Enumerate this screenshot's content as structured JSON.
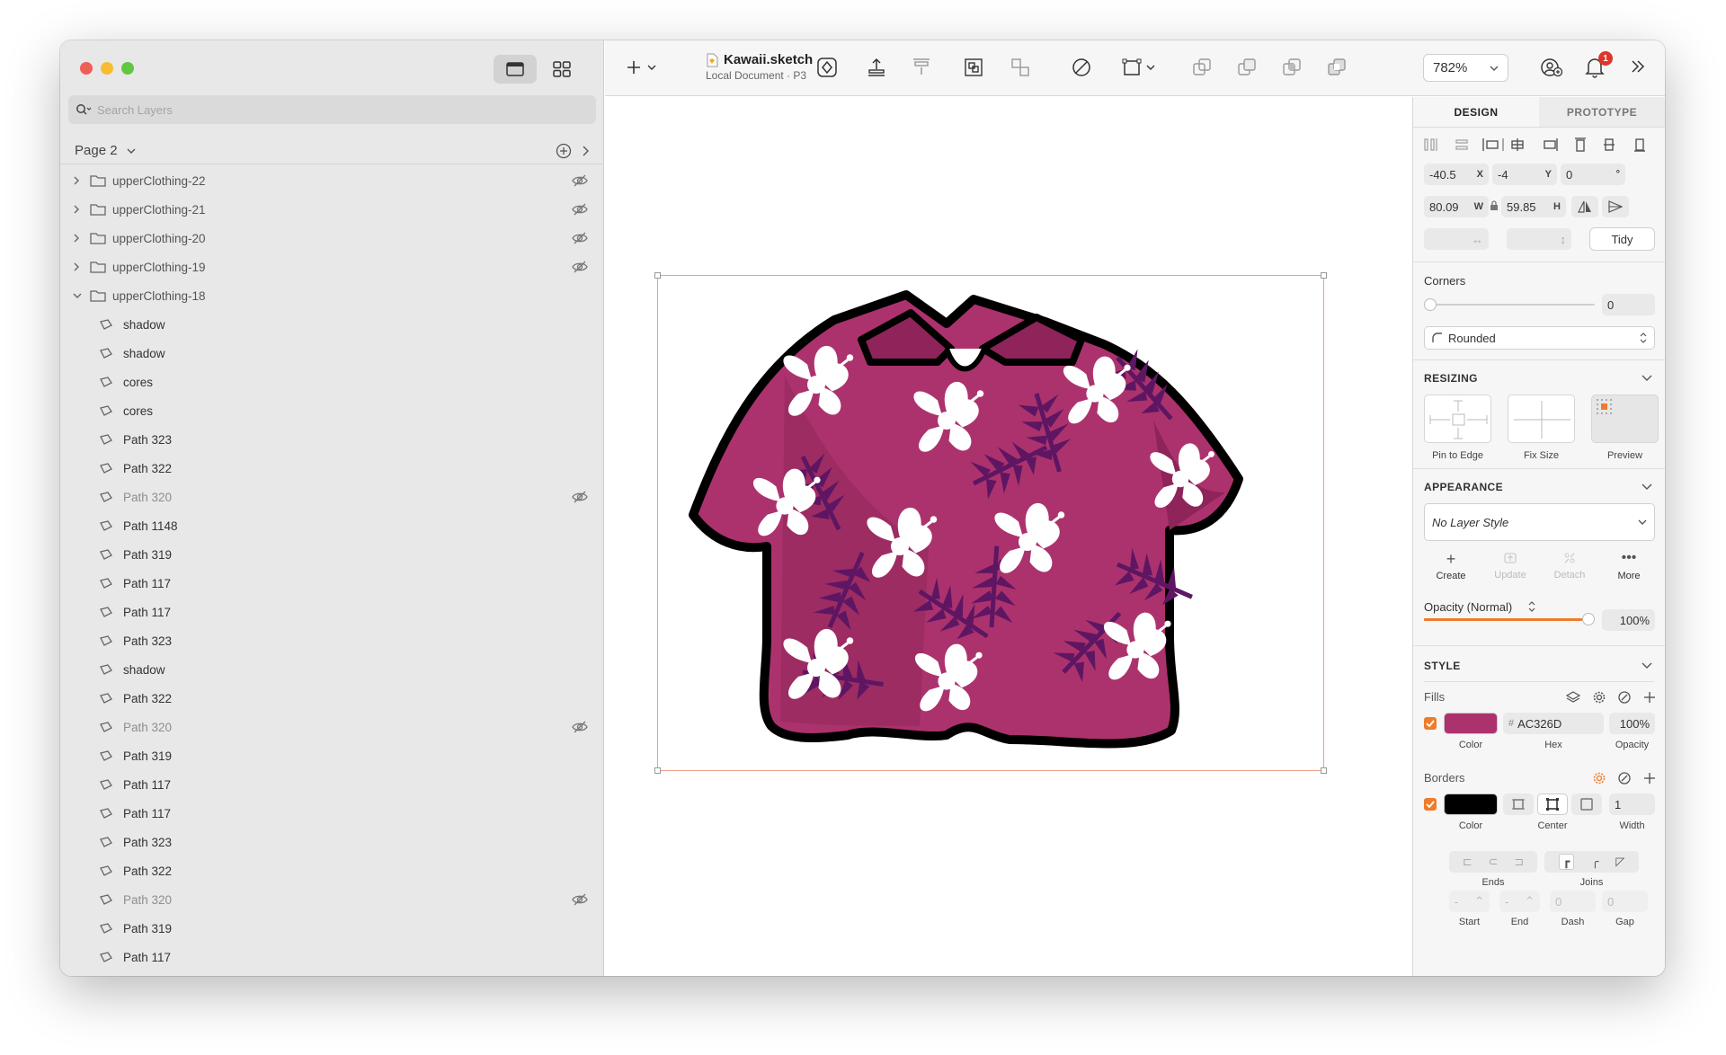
{
  "window": {
    "doc_name": "Kawaii.sketch",
    "doc_subtitle": "Local Document · P3",
    "zoom": "782%",
    "notifications": "1"
  },
  "sidebar": {
    "search_placeholder": "Search Layers",
    "page_name": "Page 2",
    "layers": [
      {
        "name": "upperClothing-22",
        "type": "group",
        "expanded": false,
        "hidden": true
      },
      {
        "name": "upperClothing-21",
        "type": "group",
        "expanded": false,
        "hidden": true
      },
      {
        "name": "upperClothing-20",
        "type": "group",
        "expanded": false,
        "hidden": true
      },
      {
        "name": "upperClothing-19",
        "type": "group",
        "expanded": false,
        "hidden": true
      },
      {
        "name": "upperClothing-18",
        "type": "group",
        "expanded": true,
        "hidden": false
      },
      {
        "name": "shadow",
        "type": "path",
        "hidden": false
      },
      {
        "name": "shadow",
        "type": "path",
        "hidden": false
      },
      {
        "name": "cores",
        "type": "path",
        "hidden": false
      },
      {
        "name": "cores",
        "type": "path",
        "hidden": false
      },
      {
        "name": "Path 323",
        "type": "path",
        "hidden": false
      },
      {
        "name": "Path 322",
        "type": "path",
        "hidden": false
      },
      {
        "name": "Path 320",
        "type": "path",
        "hidden": true
      },
      {
        "name": "Path 1148",
        "type": "path",
        "hidden": false
      },
      {
        "name": "Path 319",
        "type": "path",
        "hidden": false
      },
      {
        "name": "Path 117",
        "type": "path",
        "hidden": false
      },
      {
        "name": "Path 117",
        "type": "path",
        "hidden": false
      },
      {
        "name": "Path 323",
        "type": "path",
        "hidden": false
      },
      {
        "name": "shadow",
        "type": "path",
        "hidden": false
      },
      {
        "name": "Path 322",
        "type": "path",
        "hidden": false
      },
      {
        "name": "Path 320",
        "type": "path",
        "hidden": true
      },
      {
        "name": "Path 319",
        "type": "path",
        "hidden": false
      },
      {
        "name": "Path 117",
        "type": "path",
        "hidden": false
      },
      {
        "name": "Path 117",
        "type": "path",
        "hidden": false
      },
      {
        "name": "Path 323",
        "type": "path",
        "hidden": false
      },
      {
        "name": "Path 322",
        "type": "path",
        "hidden": false
      },
      {
        "name": "Path 320",
        "type": "path",
        "hidden": true
      },
      {
        "name": "Path 319",
        "type": "path",
        "hidden": false
      },
      {
        "name": "Path 117",
        "type": "path",
        "hidden": false
      }
    ]
  },
  "inspector": {
    "tab_design": "DESIGN",
    "tab_prototype": "PROTOTYPE",
    "x": "-40.5",
    "x_label": "X",
    "y": "-4",
    "y_label": "Y",
    "rotation": "0",
    "rotation_unit": "°",
    "w": "80.09",
    "w_label": "W",
    "h": "59.85",
    "h_label": "H",
    "tidy": "Tidy",
    "corners_label": "Corners",
    "corners_value": "0",
    "corner_style": "Rounded",
    "resizing_title": "RESIZING",
    "pin_to_edge": "Pin to Edge",
    "fix_size": "Fix Size",
    "preview": "Preview",
    "appearance_title": "APPEARANCE",
    "layer_style": "No Layer Style",
    "create": "Create",
    "update": "Update",
    "detach": "Detach",
    "more": "More",
    "opacity_label": "Opacity (Normal)",
    "opacity_value": "100%",
    "opacity_fraction": 1.0,
    "style_title": "STYLE",
    "fills_label": "Fills",
    "fill_color": "#AC326D",
    "fill_hash": "#",
    "fill_hex": "AC326D",
    "fill_opacity": "100%",
    "color_label": "Color",
    "hex_label": "Hex",
    "opacity_col_label": "Opacity",
    "borders_label": "Borders",
    "border_color": "#000000",
    "border_width": "1",
    "center_label": "Center",
    "width_label": "Width",
    "ends_label": "Ends",
    "joins_label": "Joins",
    "start_label": "Start",
    "end_label": "End",
    "dash_label": "Dash",
    "gap_label": "Gap",
    "start_value": "-",
    "end_value": "-",
    "dash_value": "0",
    "gap_value": "0"
  },
  "colors": {
    "shirt": "#AC326D",
    "shirt_shade": "#8E2459",
    "leaf": "#5E1663",
    "accent": "#F07B2A"
  }
}
